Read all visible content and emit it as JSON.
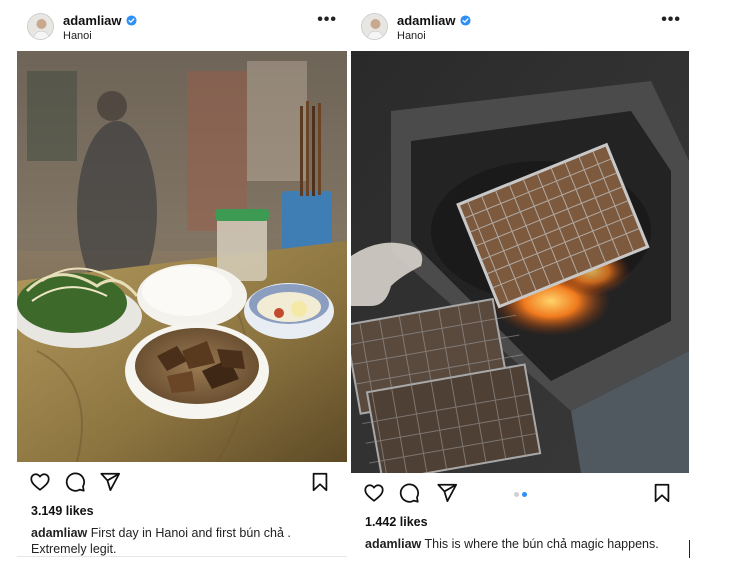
{
  "colors": {
    "verified": "#2f8ff5",
    "text": "#111111",
    "dot_active": "#2f8ff5",
    "dot_inactive": "#d0d0d0"
  },
  "posts": [
    {
      "username": "adamliaw",
      "location": "Hanoi",
      "more_label": "•••",
      "image_subject": "bowl of bún chả with noodles and herbs on a table",
      "likes": "3.149 likes",
      "caption_user": "adamliaw",
      "caption_text": " First day in Hanoi and first bún chả . Extremely legit.",
      "icons": [
        "heart-icon",
        "comment-icon",
        "share-icon",
        "bookmark-icon"
      ]
    },
    {
      "username": "adamliaw",
      "location": "Hanoi",
      "more_label": "•••",
      "image_subject": "pork grilling on wire racks over charcoal",
      "likes": "1.442 likes",
      "caption_user": "adamliaw",
      "caption_text": " This is where the bún chả magic happens.",
      "carousel_total": 2,
      "carousel_active": 2,
      "icons": [
        "heart-icon",
        "comment-icon",
        "share-icon",
        "bookmark-icon"
      ]
    }
  ]
}
